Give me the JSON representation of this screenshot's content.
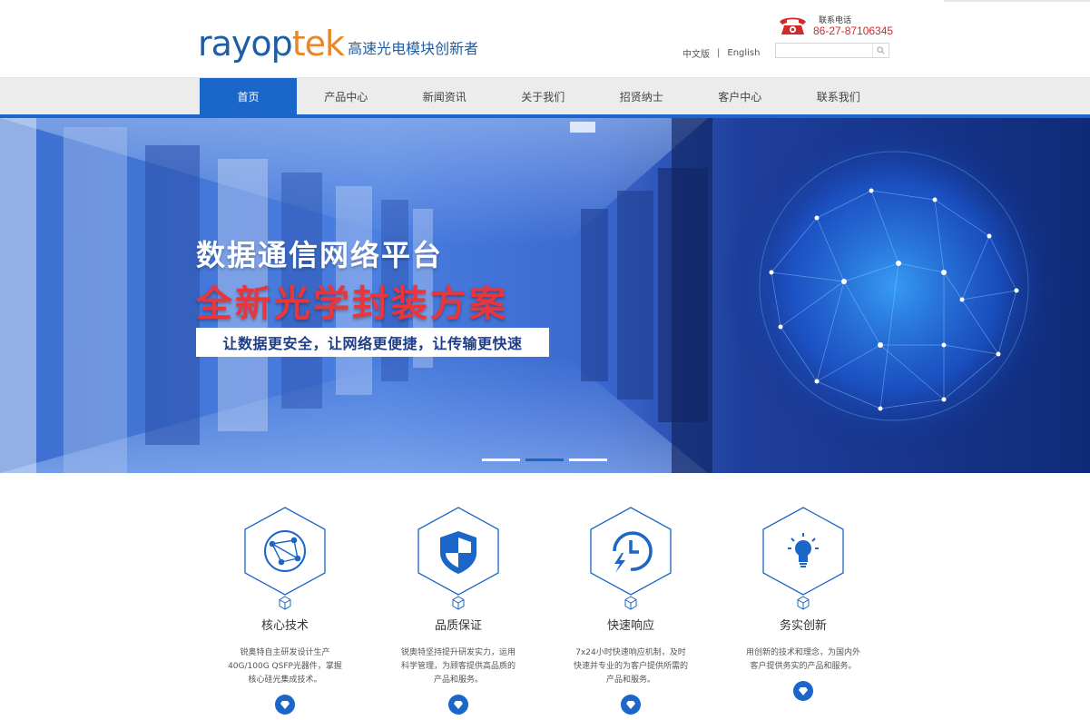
{
  "brand": {
    "logo_part1": "rayop",
    "logo_part2": "tek",
    "slogan": "高速光电模块创新者",
    "color_primary": "#1d5ea5",
    "color_accent": "#e8862a"
  },
  "contact": {
    "label": "联系电话",
    "number": "86-27-87106345",
    "icon": "telephone-icon"
  },
  "language": {
    "chinese": "中文版",
    "separator": "|",
    "english": "English"
  },
  "search": {
    "placeholder": "",
    "icon": "search-icon"
  },
  "nav": {
    "items": [
      {
        "label": "首页",
        "active": true
      },
      {
        "label": "产品中心",
        "active": false
      },
      {
        "label": "新闻资讯",
        "active": false
      },
      {
        "label": "关于我们",
        "active": false
      },
      {
        "label": "招贤纳士",
        "active": false
      },
      {
        "label": "客户中心",
        "active": false
      },
      {
        "label": "联系我们",
        "active": false
      }
    ],
    "active_color": "#1b66c9"
  },
  "banner": {
    "title1": "数据通信网络平台",
    "title2": "全新光学封装方案",
    "tagline": "让数据更安全，让网络更便捷，让传输更快速",
    "slides": 3,
    "active_slide": 2
  },
  "features": [
    {
      "icon": "network-globe-icon",
      "title": "核心技术",
      "desc": "锐奥特自主研发设计生产40G/100G QSFP光器件，掌握核心硅光集成技术。"
    },
    {
      "icon": "shield-icon",
      "title": "品质保证",
      "desc": "锐奥特坚持提升研发实力，运用科学管理，为顾客提供高品质的产品和服务。"
    },
    {
      "icon": "fast-clock-icon",
      "title": "快速响应",
      "desc": "7x24小时快速响应机制，及时快速并专业的为客户提供所需的产品和服务。"
    },
    {
      "icon": "lightbulb-icon",
      "title": "务实创新",
      "desc": "用创新的技术和理念，为国内外客户提供务实的产品和服务。"
    }
  ]
}
